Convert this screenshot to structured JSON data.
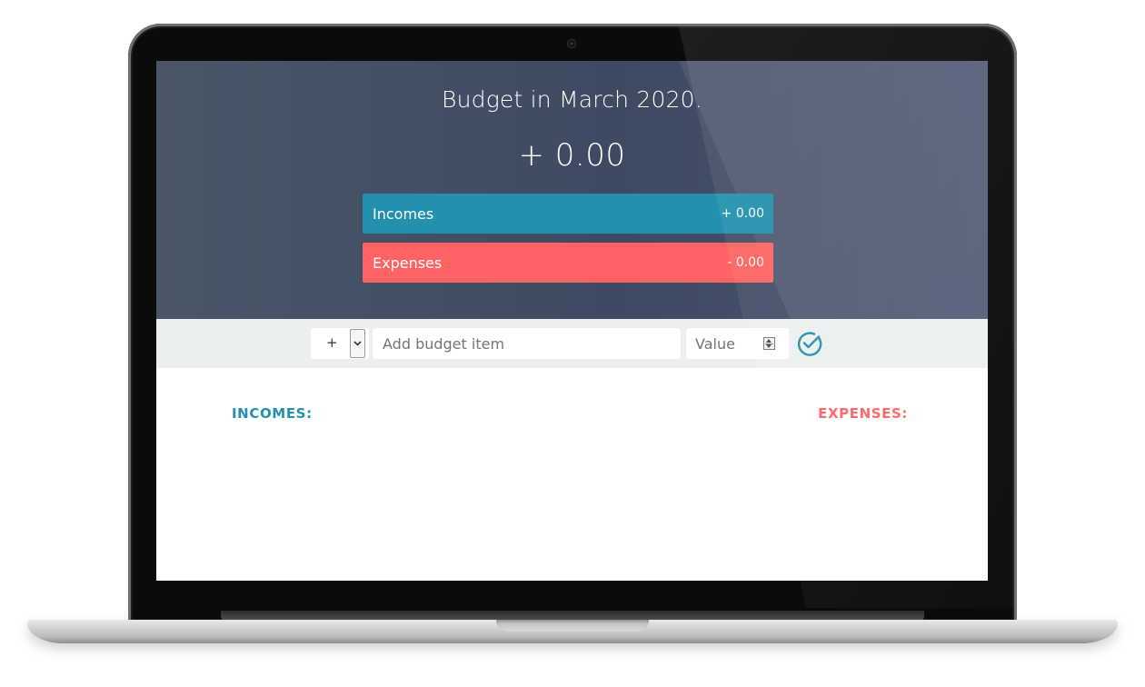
{
  "header": {
    "title": "Budget in March 2020.",
    "total": "+ 0.00",
    "income": {
      "label": "Incomes",
      "amount": "+ 0.00"
    },
    "expense": {
      "label": "Expenses",
      "amount": "- 0.00"
    }
  },
  "add_form": {
    "type_selected": "+",
    "description_placeholder": "Add budget item",
    "value_placeholder": "Value",
    "confirm_icon": "check-circle-icon"
  },
  "lists": {
    "incomes_title": "INCOMES:",
    "expenses_title": "EXPENSES:"
  },
  "colors": {
    "income": "#2290ae",
    "expense": "#ff6363",
    "header_bg": "#424e63",
    "form_bg": "#ebeff0"
  }
}
